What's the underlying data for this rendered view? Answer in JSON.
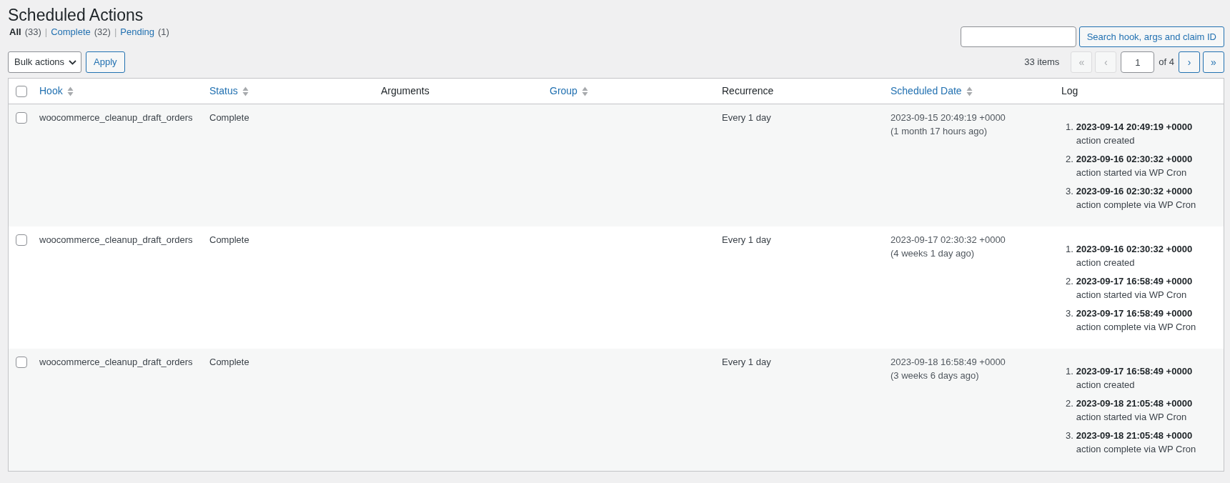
{
  "title": "Scheduled Actions",
  "views": [
    {
      "label": "All",
      "count": "(33)",
      "selected": true
    },
    {
      "separator": "|",
      "label": "Complete",
      "count": "(32)",
      "selected": false
    },
    {
      "separator": "|",
      "label": "Pending",
      "count": "(1)",
      "selected": false
    }
  ],
  "bulk_actions": {
    "label": "Bulk actions"
  },
  "apply_button": "Apply",
  "search": {
    "button": "Search hook, args and claim ID"
  },
  "pagination": {
    "items": "33 items",
    "first": {
      "label": "«",
      "disabled": true
    },
    "prev": {
      "label": "‹",
      "disabled": true
    },
    "page": "1",
    "of": "of 4",
    "next": {
      "label": "›",
      "disabled": false
    },
    "last": {
      "label": "»",
      "disabled": false
    }
  },
  "header_checked": false,
  "columns": [
    {
      "label": "Hook",
      "sortable": true
    },
    {
      "label": "Status",
      "sortable": true
    },
    {
      "label": "Arguments",
      "sortable": false
    },
    {
      "label": "Group",
      "sortable": true
    },
    {
      "label": "Recurrence",
      "sortable": false
    },
    {
      "label": "Scheduled Date",
      "sortable": true
    },
    {
      "label": "Log",
      "sortable": false
    }
  ],
  "rows": [
    {
      "checked": false,
      "hook": "woocommerce_cleanup_draft_orders",
      "status": "Complete",
      "recurrence": "Every 1 day",
      "date": "2023-09-15 20:49:19 +0000",
      "ago": "(1 month 17 hours ago)",
      "log": [
        {
          "number": "1.",
          "time": "2023-09-14 20:49:19 +0000",
          "message": "action created"
        },
        {
          "number": "2.",
          "time": "2023-09-16 02:30:32 +0000",
          "message": "action started via WP Cron"
        },
        {
          "number": "3.",
          "time": "2023-09-16 02:30:32 +0000",
          "message": "action complete via WP Cron"
        }
      ]
    },
    {
      "checked": false,
      "hook": "woocommerce_cleanup_draft_orders",
      "status": "Complete",
      "recurrence": "Every 1 day",
      "date": "2023-09-17 02:30:32 +0000",
      "ago": "(4 weeks 1 day ago)",
      "log": [
        {
          "number": "1.",
          "time": "2023-09-16 02:30:32 +0000",
          "message": "action created"
        },
        {
          "number": "2.",
          "time": "2023-09-17 16:58:49 +0000",
          "message": "action started via WP Cron"
        },
        {
          "number": "3.",
          "time": "2023-09-17 16:58:49 +0000",
          "message": "action complete via WP Cron"
        }
      ]
    },
    {
      "checked": false,
      "hook": "woocommerce_cleanup_draft_orders",
      "status": "Complete",
      "recurrence": "Every 1 day",
      "date": "2023-09-18 16:58:49 +0000",
      "ago": "(3 weeks 6 days ago)",
      "log": [
        {
          "number": "1.",
          "time": "2023-09-17 16:58:49 +0000",
          "message": "action created"
        },
        {
          "number": "2.",
          "time": "2023-09-18 21:05:48 +0000",
          "message": "action started via WP Cron"
        },
        {
          "number": "3.",
          "time": "2023-09-18 21:05:48 +0000",
          "message": "action complete via WP Cron"
        }
      ]
    }
  ]
}
